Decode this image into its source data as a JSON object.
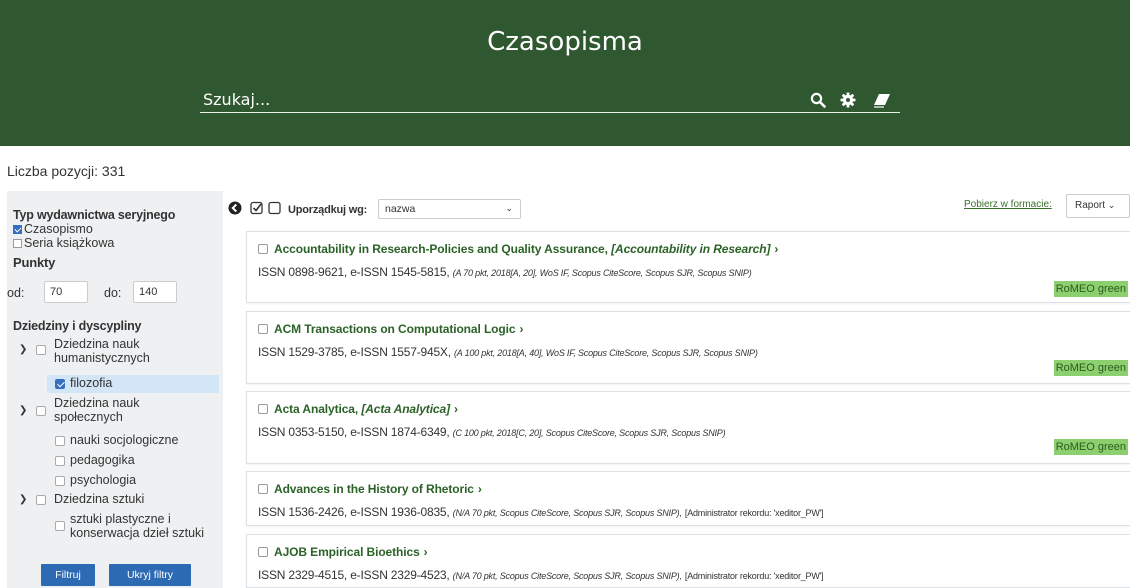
{
  "header": {
    "title": "Czasopisma",
    "search_placeholder": "Szukaj..."
  },
  "count_label": "Liczba pozycji: 331",
  "filters": {
    "type_heading": "Typ wydawnictwa seryjnego",
    "type_options": [
      {
        "label": "Czasopismo",
        "checked": true
      },
      {
        "label": "Seria książkowa",
        "checked": false
      }
    ],
    "points_heading": "Punkty",
    "from_label": "od:",
    "from_value": "70",
    "to_label": "do:",
    "to_value": "140",
    "disciplines_heading": "Dziedziny i dyscypliny",
    "groups": [
      {
        "label_line1": "Dziedzina nauk",
        "label_line2": "humanistycznych",
        "items": [
          {
            "label": "filozofia",
            "checked": true
          }
        ]
      },
      {
        "label_line1": "Dziedzina nauk",
        "label_line2": "społecznych",
        "items": [
          {
            "label": "nauki socjologiczne"
          },
          {
            "label": "pedagogika"
          },
          {
            "label": "psychologia"
          }
        ]
      },
      {
        "label_line1": "Dziedzina sztuki",
        "items": [
          {
            "label_line1": "sztuki plastyczne i",
            "label_line2": "konserwacja dzieł sztuki"
          }
        ]
      }
    ],
    "filter_button": "Filtruj",
    "hide_button": "Ukryj filtry"
  },
  "toolbar": {
    "sort_label": "Uporządkuj wg:",
    "sort_value": "nazwa",
    "download_label": "Pobierz w formacie:",
    "report_label": "Raport"
  },
  "journals": [
    {
      "title": "Accountability in Research-Policies and Quality Assurance,",
      "alt_title": "[Accountability in Research]",
      "issn": "ISSN 0898-9621, e-ISSN 1545-5815,",
      "meta": "(A 70 pkt, 2018[A, 20], WoS IF, Scopus CiteScore, Scopus SJR, Scopus SNIP)",
      "admin": "",
      "romeo": "RoMEO green"
    },
    {
      "title": "ACM Transactions on Computational Logic",
      "alt_title": "",
      "issn": "ISSN 1529-3785, e-ISSN 1557-945X,",
      "meta": "(A 100 pkt, 2018[A, 40], WoS IF, Scopus CiteScore, Scopus SJR, Scopus SNIP)",
      "admin": "",
      "romeo": "RoMEO green"
    },
    {
      "title": "Acta Analytica,",
      "alt_title": "[Acta Analytica]",
      "issn": "ISSN 0353-5150, e-ISSN 1874-6349,",
      "meta": "(C 100 pkt, 2018[C, 20], Scopus CiteScore, Scopus SJR, Scopus SNIP)",
      "admin": "",
      "romeo": "RoMEO green"
    },
    {
      "title": "Advances in the History of Rhetoric",
      "alt_title": "",
      "issn": "ISSN 1536-2426, e-ISSN 1936-0835,",
      "meta": "(N/A 70 pkt, Scopus CiteScore, Scopus SJR, Scopus SNIP),",
      "admin": "[Administrator rekordu: 'xeditor_PW']",
      "romeo": ""
    },
    {
      "title": "AJOB Empirical Bioethics",
      "alt_title": "",
      "issn": "ISSN 2329-4515, e-ISSN 2329-4523,",
      "meta": "(N/A 70 pkt, Scopus CiteScore, Scopus SJR, Scopus SNIP),",
      "admin": "[Administrator rekordu: 'xeditor_PW']",
      "romeo": ""
    }
  ],
  "colors": {
    "header_bg": "#2f5730",
    "link_green": "#2b6228",
    "romeo_badge": "#8ccf6f",
    "button_blue": "#2d6ab4",
    "highlight": "#d3e6f7"
  }
}
